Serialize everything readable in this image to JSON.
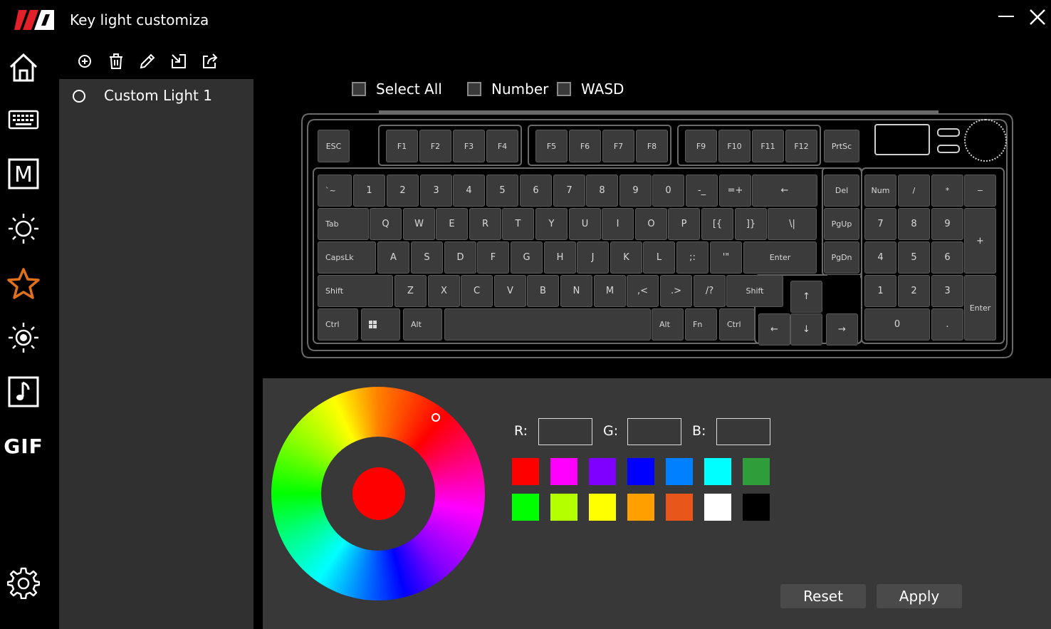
{
  "window": {
    "title": "Key light customiza"
  },
  "nav": [
    {
      "icon": "home-icon"
    },
    {
      "icon": "keyboard-icon"
    },
    {
      "icon": "macro-icon",
      "glyph": "M"
    },
    {
      "icon": "lighting-icon"
    },
    {
      "icon": "star-icon",
      "active": true,
      "active_color": "#e0701a"
    },
    {
      "icon": "brightness-icon"
    },
    {
      "icon": "music-icon"
    },
    {
      "icon": "gif-icon",
      "label": "GIF"
    },
    {
      "icon": "gear-icon"
    }
  ],
  "toolbar": [
    "add-icon",
    "trash-icon",
    "pencil-icon",
    "import-icon",
    "export-icon"
  ],
  "profiles": [
    {
      "label": "Custom Light 1"
    }
  ],
  "selection": {
    "select_all": "Select All",
    "number": "Number",
    "wasd": "WASD"
  },
  "keyboard": {
    "row_fn": [
      "ESC",
      "F1",
      "F2",
      "F3",
      "F4",
      "F5",
      "F6",
      "F7",
      "F8",
      "F9",
      "F10",
      "F11",
      "F12",
      "PrtSc"
    ],
    "row_num": [
      "`~",
      "1",
      "2",
      "3",
      "4",
      "5",
      "6",
      "7",
      "8",
      "9",
      "0",
      "-_",
      "=+",
      "←",
      "Del",
      "Num",
      "/",
      "*",
      "−"
    ],
    "row_tab": [
      "Tab",
      "Q",
      "W",
      "E",
      "R",
      "T",
      "Y",
      "U",
      "I",
      "O",
      "P",
      "[{",
      "]}",
      "\\|",
      "PgUp",
      "7",
      "8",
      "9",
      "+"
    ],
    "row_caps": [
      "CapsLk",
      "A",
      "S",
      "D",
      "F",
      "G",
      "H",
      "J",
      "K",
      "L",
      ";:",
      "'\"",
      "Enter",
      "PgDn",
      "4",
      "5",
      "6"
    ],
    "row_shift": [
      "Shift",
      "Z",
      "X",
      "C",
      "V",
      "B",
      "N",
      "M",
      ",<",
      ".>",
      "/?",
      "Shift",
      "↑",
      "1",
      "2",
      "3",
      "Enter"
    ],
    "row_ctrl": [
      "Ctrl",
      "win-icon",
      "Alt",
      "",
      "Alt",
      "Fn",
      "Ctrl",
      "←",
      "↓",
      "→",
      "0",
      "."
    ]
  },
  "color": {
    "selected": "#ff0000",
    "r_label": "R:",
    "g_label": "G:",
    "b_label": "B:",
    "r": "",
    "g": "",
    "b": "",
    "swatches": [
      "#ff0000",
      "#ff00ff",
      "#8000ff",
      "#0000ff",
      "#0080ff",
      "#00ffff",
      "#2f9e3a",
      "#00ff00",
      "#b4ff00",
      "#ffff00",
      "#ffa000",
      "#e8561a",
      "#ffffff",
      "#000000"
    ]
  },
  "actions": {
    "reset": "Reset",
    "apply": "Apply"
  }
}
